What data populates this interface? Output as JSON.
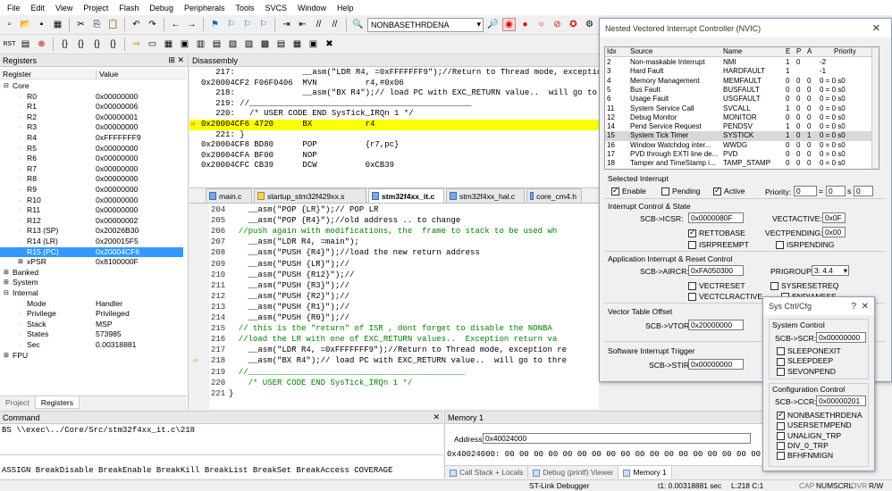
{
  "menu": [
    "File",
    "Edit",
    "View",
    "Project",
    "Flash",
    "Debug",
    "Peripherals",
    "Tools",
    "SVCS",
    "Window",
    "Help"
  ],
  "toolbar": {
    "target_combo": "NONBASETHRDENA"
  },
  "registers": {
    "title": "Registers",
    "col_register": "Register",
    "col_value": "Value",
    "core_label": "Core",
    "rows": [
      {
        "name": "R0",
        "value": "0x00000000"
      },
      {
        "name": "R1",
        "value": "0x00000006"
      },
      {
        "name": "R2",
        "value": "0x00000001"
      },
      {
        "name": "R3",
        "value": "0x00000000"
      },
      {
        "name": "R4",
        "value": "0xFFFFFFF9"
      },
      {
        "name": "R5",
        "value": "0x00000000"
      },
      {
        "name": "R6",
        "value": "0x00000000"
      },
      {
        "name": "R7",
        "value": "0x00000000"
      },
      {
        "name": "R8",
        "value": "0x00000000"
      },
      {
        "name": "R9",
        "value": "0x00000000"
      },
      {
        "name": "R10",
        "value": "0x00000000"
      },
      {
        "name": "R11",
        "value": "0x00000000"
      },
      {
        "name": "R12",
        "value": "0x00000002"
      },
      {
        "name": "R13 (SP)",
        "value": "0x20026B30"
      },
      {
        "name": "R14 (LR)",
        "value": "0x200015F5"
      },
      {
        "name": "R15 (PC)",
        "value": "0x20004CF6"
      },
      {
        "name": "xPSR",
        "value": "0x8100000F"
      }
    ],
    "groups": [
      "Banked",
      "System",
      "Internal"
    ],
    "internal": [
      {
        "name": "Mode",
        "value": "Handler"
      },
      {
        "name": "Privilege",
        "value": "Privileged"
      },
      {
        "name": "Stack",
        "value": "MSP"
      },
      {
        "name": "States",
        "value": "573985"
      },
      {
        "name": "Sec",
        "value": "0.00318881"
      }
    ],
    "fpu": "FPU",
    "bottom_tabs": [
      "Project",
      "Registers"
    ]
  },
  "disassembly": {
    "title": "Disassembly",
    "lines": [
      "   217:              __asm(\"LDR R4, =0xFFFFFFF9\");//Return to Thread mode, exception return",
      "0x20004CF2 F06F0406  MVN          r4,#0x06",
      "   218:              __asm(\"BX R4\");// load PC with EXC_RETURN value..  will go to thre",
      "   219: //______________________________________________",
      "   220:   /* USER CODE END SysTick_IRQn 1 */",
      "0x20004CF6 4720      BX           r4",
      "   221: }",
      "0x20004CF8 BD80      POP          {r7,pc}",
      "0x20004CFA BF00      NOP",
      "0x20004CFC CB39      DCW          0xCB39"
    ]
  },
  "editor": {
    "tabs": [
      "main.c",
      "startup_stm32f429xx.s",
      "stm32f4xx_it.c",
      "stm32f4xx_hal.c",
      "core_cm4.h"
    ],
    "lines": [
      {
        "no": "204",
        "text": "    __asm(\"POP {LR}\");// POP LR"
      },
      {
        "no": "205",
        "text": "    __asm(\"POP {R4}\");//old address .. to change"
      },
      {
        "no": "206",
        "text": "  //push again with modifications, the  frame to stack to be used wh"
      },
      {
        "no": "207",
        "text": "    __asm(\"LDR R4, =main\");"
      },
      {
        "no": "208",
        "text": "    __asm(\"PUSH {R4}\");//load the new return address"
      },
      {
        "no": "209",
        "text": "    __asm(\"PUSH {LR}\");//"
      },
      {
        "no": "210",
        "text": "    __asm(\"PUSH {R12}\");//"
      },
      {
        "no": "211",
        "text": "    __asm(\"PUSH {R3}\");//"
      },
      {
        "no": "212",
        "text": "    __asm(\"PUSH {R2}\");//"
      },
      {
        "no": "213",
        "text": "    __asm(\"PUSH {R1}\");//"
      },
      {
        "no": "214",
        "text": "    __asm(\"PUSH {R0}\");//"
      },
      {
        "no": "215",
        "text": "  // this is the \"return\" of ISR , dont forget to disable the NONBA"
      },
      {
        "no": "216",
        "text": "  //load the LR with one of EXC_RETURN values..  Exception return va"
      },
      {
        "no": "217",
        "text": "    __asm(\"LDR R4, =0xFFFFFFF9\");//Return to Thread mode, exception re"
      },
      {
        "no": "218",
        "text": "    __asm(\"BX R4\");// load PC with EXC_RETURN value..  will go to thre"
      },
      {
        "no": "219",
        "text": "  //_____________________________________________"
      },
      {
        "no": "220",
        "text": "    /* USER CODE END SysTick_IRQn 1 */"
      },
      {
        "no": "221",
        "text": "}"
      }
    ]
  },
  "command": {
    "title": "Command",
    "line1": "BS \\\\exec\\../Core/Src/stm32f4xx_it.c\\218",
    "line2": "ASSIGN BreakDisable BreakEnable BreakKill BreakList BreakSet BreakAccess COVERAGE"
  },
  "memory": {
    "title": "Memory 1",
    "address_label": "Address:",
    "address_value": "0x40024000",
    "dump": "0x40024000: 00 00 00 00 00 00 00 00 00 00 00 00 00 00 00 00 00 00 00 00",
    "tabs": [
      "Call Stack + Locals",
      "Debug (printf) Viewer",
      "Memory 1"
    ]
  },
  "nvic": {
    "title": "Nested Vectored Interrupt Controller (NVIC)",
    "cols": [
      "Idx",
      "Source",
      "Name",
      "E",
      "P",
      "A",
      "Priority"
    ],
    "rows": [
      {
        "idx": "2",
        "src": "Non-maskable Interrupt",
        "name": "NMI",
        "e": "1",
        "p": "0",
        "a": "",
        "pr": "-2"
      },
      {
        "idx": "3",
        "src": "Hard Fault",
        "name": "HARDFAULT",
        "e": "1",
        "p": "",
        "a": "",
        "pr": "-1"
      },
      {
        "idx": "4",
        "src": "Memory Management",
        "name": "MEMFAULT",
        "e": "0",
        "p": "0",
        "a": "0",
        "pr": "0 = 0 s0"
      },
      {
        "idx": "5",
        "src": "Bus Fault",
        "name": "BUSFAULT",
        "e": "0",
        "p": "0",
        "a": "0",
        "pr": "0 = 0 s0"
      },
      {
        "idx": "6",
        "src": "Usage Fault",
        "name": "USGFAULT",
        "e": "0",
        "p": "0",
        "a": "0",
        "pr": "0 = 0 s0"
      },
      {
        "idx": "11",
        "src": "System Service Call",
        "name": "SVCALL",
        "e": "1",
        "p": "0",
        "a": "0",
        "pr": "0 = 0 s0"
      },
      {
        "idx": "12",
        "src": "Debug Monitor",
        "name": "MONITOR",
        "e": "0",
        "p": "0",
        "a": "0",
        "pr": "0 = 0 s0"
      },
      {
        "idx": "14",
        "src": "Pend Service Request",
        "name": "PENDSV",
        "e": "1",
        "p": "0",
        "a": "0",
        "pr": "0 = 0 s0"
      },
      {
        "idx": "15",
        "src": "System Tick Timer",
        "name": "SYSTICK",
        "e": "1",
        "p": "0",
        "a": "1",
        "pr": "0 = 0 s0"
      },
      {
        "idx": "16",
        "src": "Window Watchdog inter...",
        "name": "WWDG",
        "e": "0",
        "p": "0",
        "a": "0",
        "pr": "0 = 0 s0"
      },
      {
        "idx": "17",
        "src": "PVD through EXTI line de...",
        "name": "PVD",
        "e": "0",
        "p": "0",
        "a": "0",
        "pr": "0 = 0 s0"
      },
      {
        "idx": "18",
        "src": "Tamper and TimeStamp i...",
        "name": "TAMP_STAMP",
        "e": "0",
        "p": "0",
        "a": "0",
        "pr": "0 = 0 s0"
      }
    ],
    "sel_title": "Selected Interrupt",
    "enable": "Enable",
    "pending": "Pending",
    "active": "Active",
    "priority": "Priority:",
    "prio_vals": [
      "0",
      "0",
      "0"
    ],
    "ics_title": "Interrupt Control & State",
    "icsr_label": "SCB->ICSR:",
    "icsr_value": "0x0000080F",
    "vectactive_label": "VECTACTIVE:",
    "vectactive_value": "0x0F",
    "rettobase": "RETTOBASE",
    "vectpending_label": "VECTPENDING:",
    "vectpending_value": "0x00",
    "isrpreempt": "ISRPREEMPT",
    "isrpending": "ISRPENDING",
    "aircr_title": "Application Interrupt & Reset Control",
    "aircr_label": "SCB->AIRCR:",
    "aircr_value": "0xFA050300",
    "prigroup_label": "PRIGROUP:",
    "prigroup_value": "3: 4.4",
    "vectreset": "VECTRESET",
    "sysresetreq": "SYSRESETREQ",
    "vectclractive": "VECTCLRACTIVE",
    "endianess": "ENDIANESS",
    "vtor_title": "Vector Table Offset",
    "vtor_label": "SCB->VTOR:",
    "vtor_value": "0x20000000",
    "stir_title": "Software Interrupt Trigger",
    "stir_label": "SCB->STIR:",
    "stir_value": "0x00000000"
  },
  "sysctrl": {
    "title": "Sys Ctrl/Cfg",
    "sc_title": "System Control",
    "scr_label": "SCB->SCR:",
    "scr_value": "0x00000000",
    "sc_items": [
      "SLEEPONEXIT",
      "SLEEPDEEP",
      "SEVONPEND"
    ],
    "cc_title": "Configuration Control",
    "ccr_label": "SCB->CCR:",
    "ccr_value": "0x00000201",
    "cc_items": [
      "NONBASETHRDENA",
      "USERSETMPEND",
      "UNALIGN_TRP",
      "DIV_0_TRP",
      "BFHFNMIGN"
    ]
  },
  "statusbar": {
    "debugger": "ST-Link Debugger",
    "time": "t1: 0.00318881 sec",
    "pos": "L:218 C:1",
    "caps": "CAP",
    "num": "NUM",
    "scrl": "SCRL",
    "ovr": "OVR",
    "rw": "R/W"
  },
  "colors": {
    "highlight": "#ffff00",
    "selection": "#3399ff",
    "comment": "#008000",
    "string": "#800080"
  }
}
